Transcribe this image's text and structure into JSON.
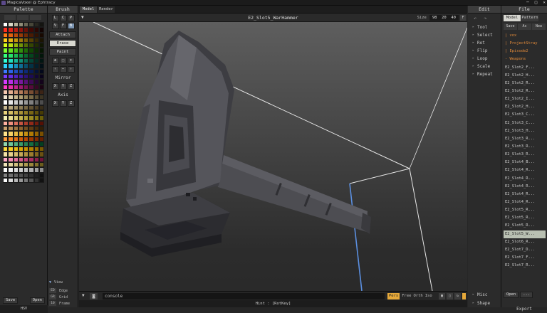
{
  "window": {
    "title": "MagicaVoxel @ Ephtracy",
    "controls": [
      "─",
      "□",
      "✕"
    ]
  },
  "palette": {
    "title": "Palette",
    "tabs": [
      "",
      "",
      ""
    ],
    "save": "Save",
    "open": "Open",
    "mode": "HSV",
    "colors": [
      "#ffffff",
      "#d9d9c7",
      "#b6b39b",
      "#8f8c77",
      "#6a6756",
      "#474638",
      "#27261f",
      "#141410",
      "#ff2e1f",
      "#d92519",
      "#b21d13",
      "#8c150d",
      "#661008",
      "#3f0904",
      "#2a0703",
      "#120302",
      "#ff7a14",
      "#e0600e",
      "#bb4a0a",
      "#963a07",
      "#702a05",
      "#4a1b03",
      "#311202",
      "#180901",
      "#ffd21c",
      "#e6b414",
      "#c2960e",
      "#9e780a",
      "#7a5c07",
      "#554004",
      "#362803",
      "#1b1401",
      "#d9ff1a",
      "#b8e011",
      "#93b80c",
      "#719108",
      "#516b05",
      "#344503",
      "#1f2c02",
      "#0f1601",
      "#7dff2e",
      "#5fe01f",
      "#46b815",
      "#31910d",
      "#1f6b07",
      "#114504",
      "#0a2c02",
      "#051601",
      "#35ff7e",
      "#26e06a",
      "#1ab854",
      "#109141",
      "#086b2f",
      "#04451e",
      "#022c13",
      "#011609",
      "#30ffd6",
      "#22e0bb",
      "#18b898",
      "#0f9176",
      "#086b56",
      "#044537",
      "#022c24",
      "#011612",
      "#2fd6ff",
      "#20b5e6",
      "#1690bd",
      "#0e6d94",
      "#084e6b",
      "#043245",
      "#021f2c",
      "#010f16",
      "#3c7bff",
      "#2b63e6",
      "#1f4ec2",
      "#163b9e",
      "#0e2a7a",
      "#081b55",
      "#041136",
      "#02081b",
      "#7a3cff",
      "#652ee6",
      "#5023c2",
      "#3d199e",
      "#2c117a",
      "#1d0b55",
      "#120636",
      "#09031b",
      "#d43cff",
      "#b82ee6",
      "#9823c2",
      "#78199e",
      "#59117a",
      "#3c0b55",
      "#250636",
      "#13031b",
      "#ff3cc8",
      "#e62eac",
      "#c2238f",
      "#9e1974",
      "#7a1157",
      "#550b3b",
      "#360625",
      "#1b0312",
      "#f5c9b0",
      "#e2ad8f",
      "#cc9473",
      "#b37b5a",
      "#966445",
      "#784d32",
      "#5a3723",
      "#3c2416",
      "#f2e6d0",
      "#ddcfae",
      "#c7b78f",
      "#b09f74",
      "#96855c",
      "#7a6b47",
      "#5c5035",
      "#3d3523",
      "#ffffff",
      "#e6e6e6",
      "#cccccc",
      "#b3b3b3",
      "#999999",
      "#808080",
      "#666666",
      "#4d4d4d",
      "#c8b890",
      "#b5a57c",
      "#a09068",
      "#8b7b55",
      "#766643",
      "#625233",
      "#4d3f25",
      "#382d19",
      "#e8d27c",
      "#d4bd63",
      "#bfa74c",
      "#a99137",
      "#917b24",
      "#796515",
      "#60500a",
      "#473b04",
      "#f5f0b4",
      "#e6dd91",
      "#d6c970",
      "#c4b552",
      "#b0a038",
      "#9a8a23",
      "#827413",
      "#6a5e08",
      "#ffb0a0",
      "#f0907e",
      "#dd715e",
      "#c65542",
      "#ad3d2b",
      "#912a19",
      "#731b0c",
      "#551004",
      "#c8a06e",
      "#b58a56",
      "#a07541",
      "#8b612f",
      "#744e20",
      "#5e3c14",
      "#472c0b",
      "#321e05",
      "#ffe28a",
      "#f5cf64",
      "#e8bb42",
      "#d9a626",
      "#c79012",
      "#b07a05",
      "#966401",
      "#7a4f00",
      "#ff9c3c",
      "#f28526",
      "#e26f14",
      "#ce5a08",
      "#b64702",
      "#9c3700",
      "#812a00",
      "#661f00",
      "#8fd6b0",
      "#6fc497",
      "#52b07f",
      "#3a9b69",
      "#258454",
      "#146d41",
      "#09562f",
      "#033f20",
      "#ffd93c",
      "#f5c926",
      "#e8b814",
      "#d9a608",
      "#c79302",
      "#b08000",
      "#966c00",
      "#7a5800",
      "#f3e3a6",
      "#e6d18a",
      "#d6bd6f",
      "#c4a857",
      "#b09241",
      "#9a7c2e",
      "#82661e",
      "#6a5112",
      "#ffa8c8",
      "#f58cb3",
      "#e6719e",
      "#d45889",
      "#bf4174",
      "#a72e60",
      "#8c1f4c",
      "#701339",
      "#efe5b8",
      "#e2d59c",
      "#d3c381",
      "#c2b068",
      "#af9c51",
      "#9a873c",
      "#83712a",
      "#6b5c1c",
      "#ffffff",
      "#f0f0f0",
      "#e0e0e0",
      "#d0d0d0",
      "#c0c0c0",
      "#b0b0b0",
      "#a0a0a0",
      "#909090",
      "#808080",
      "#707070",
      "#606060",
      "#505050",
      "#404040",
      "#303030",
      "#202020",
      "#101010",
      "#ffffff",
      "#dddddd",
      "#bbbbbb",
      "#999999",
      "#777777",
      "#555555",
      "#333333",
      "#111111"
    ]
  },
  "brush": {
    "title": "Brush",
    "shape_row1": [
      "L",
      "C",
      "P"
    ],
    "shape_row2": [
      "V",
      "F",
      "B"
    ],
    "modes": [
      "Attach",
      "Erase",
      "Paint"
    ],
    "mirror_label": "Mirror",
    "axis_label": "Axis",
    "xyz": [
      "X",
      "Y",
      "Z"
    ],
    "view_label": "View",
    "edge_label": "Edge",
    "grid_label": "Grid",
    "frame_label": "Frame",
    "key_edge": "ED",
    "key_grid": "GR",
    "frame_value": "10"
  },
  "viewport": {
    "tabs": [
      "Model",
      "Render"
    ],
    "file_title": "E2_Slot5_WarHammer",
    "size_label": "Size",
    "size": {
      "x": "98",
      "y": "20",
      "z": "40"
    },
    "console_placeholder": "console",
    "modes": [
      "Pers",
      "Free",
      "Orth",
      "Iso"
    ],
    "hint": "Hint : [RotKey]"
  },
  "edit": {
    "title": "Edit",
    "items": [
      "Tool",
      "Select",
      "Rot",
      "Flip",
      "Loop",
      "Scale",
      "Repeat"
    ],
    "misc": "Misc",
    "shape": "Shape"
  },
  "file": {
    "title": "File",
    "tabs": [
      "Model",
      "Pattern"
    ],
    "buttons": [
      "Save",
      "As",
      "New"
    ],
    "items": [
      "| vox",
      "| ProjectStray",
      "| Episode2",
      "- Weapons",
      "E2_Slot2_F...",
      "E2_Slot2_H...",
      "E2_Slot2_R...",
      "E2_Slot2_R...",
      "E2_Slot2_I...",
      "E2_Slot2_H...",
      "E2_Slot3_C...",
      "E2_Slot3_C...",
      "E2_Slot3_H...",
      "E2_Slot3_R...",
      "E2_Slot3_R...",
      "E2_Slot3_R...",
      "E2_Slot4_B...",
      "E2_Slot4_R...",
      "E2_Slot4_R...",
      "E2_Slot4_R...",
      "E2_Slot4_R...",
      "E2_Slot4_R...",
      "E2_Slot5_R...",
      "E2_Slot5_R...",
      "E2_Slot5_R...",
      "E2_Slot5_W...",
      "E2_Slot6_R...",
      "E2_Slot7_D...",
      "E2_Slot7_F...",
      "E2_Slot7_R..."
    ],
    "selected_index": 25,
    "open": "Open",
    "more": "...",
    "export": "Export"
  }
}
